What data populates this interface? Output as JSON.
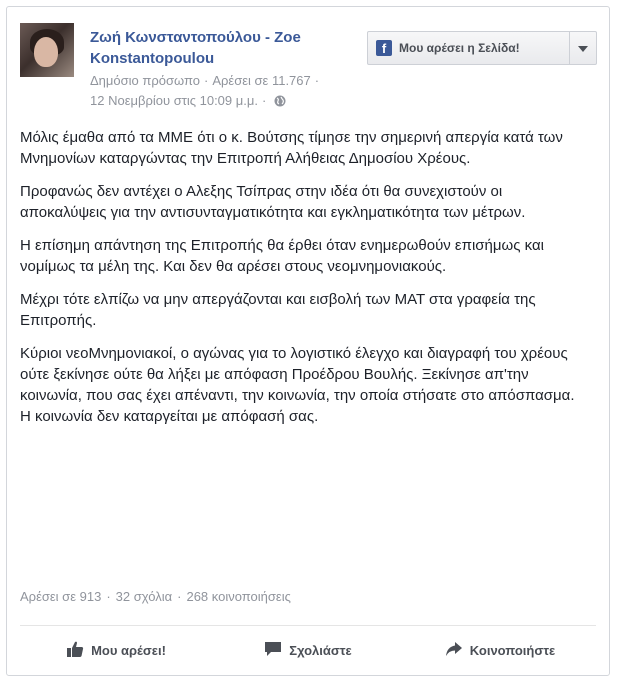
{
  "post": {
    "author": "Ζωή Κωνσταντοπούλου - Zoe Konstantopoulou",
    "category": "Δημόσιο πρόσωπο",
    "page_likes": "Αρέσει σε 11.767",
    "timestamp": "12 Νοεμβρίου στις 10:09 μ.μ.",
    "paragraphs": [
      "Μόλις έμαθα από τα ΜΜΕ ότι ο κ. Βούτσης τίμησε την σημερινή απεργία κατά των Μνημονίων καταργώντας την Επιτροπή Αλήθειας Δημοσίου Χρέους.",
      "Προφανώς δεν αντέχει ο Αλεξης Τσίπρας στην ιδέα ότι θα συνεχιστούν οι αποκαλύψεις για την αντισυνταγματικότητα και εγκληματικότητα των μέτρων.",
      "Η επίσημη απάντηση της Επιτροπής θα έρθει όταν ενημερωθούν επισήμως και νομίμως τα μέλη της. Και δεν θα αρέσει στους νεομνημονιακούς.",
      "Μέχρι τότε ελπίζω να μην απεργάζονται και εισβολή των ΜΑΤ στα γραφεία της Επιτροπής.",
      "Κύριοι νεοΜνημονιακοί, ο αγώνας για το λογιστικό έλεγχο και διαγραφή του χρέους ούτε ξεκίνησε ούτε θα λήξει με απόφαση Προέδρου Βουλής. Ξεκίνησε απ'την κοινωνία, που σας έχει απέναντι, την κοινωνία, την οποία στήσατε στο απόσπασμα. Η κοινωνία δεν καταργείται με απόφασή σας."
    ],
    "stats": {
      "likes": "Αρέσει σε 913",
      "comments": "32 σχόλια",
      "shares": "268 κοινοποιήσεις"
    }
  },
  "like_page_button": {
    "label": "Μου αρέσει η Σελίδα!",
    "icon": "facebook-icon",
    "dropdown_icon": "caret-down-icon"
  },
  "actions": {
    "like": "Μου αρέσει!",
    "comment": "Σχολιάστε",
    "share": "Κοινοποιήστε"
  },
  "colors": {
    "brand": "#3b5998",
    "text": "#1d2129",
    "meta": "#90949c",
    "action": "#4b4f56"
  }
}
